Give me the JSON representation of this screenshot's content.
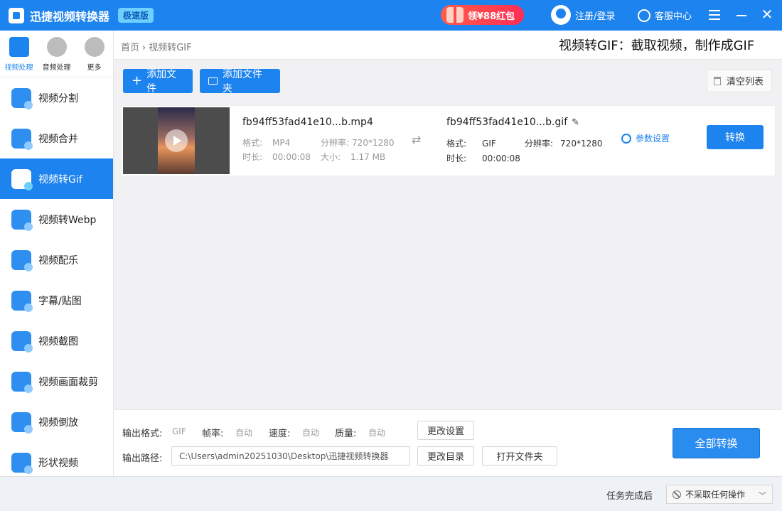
{
  "app": {
    "title": "迅捷视频转换器",
    "edition": "极速版",
    "promo": "领¥88红包",
    "login": "注册/登录",
    "service": "客服中心"
  },
  "sidebar": {
    "top_tabs": [
      {
        "label": "视频处理"
      },
      {
        "label": "音频处理"
      },
      {
        "label": "更多"
      }
    ],
    "items": [
      {
        "label": "视频分割"
      },
      {
        "label": "视频合并"
      },
      {
        "label": "视频转Gif"
      },
      {
        "label": "视频转Webp"
      },
      {
        "label": "视频配乐"
      },
      {
        "label": "字幕/贴图"
      },
      {
        "label": "视频截图"
      },
      {
        "label": "视频画面裁剪"
      },
      {
        "label": "视频倒放"
      },
      {
        "label": "形状视频"
      }
    ]
  },
  "header": {
    "breadcrumb_home": "首页",
    "breadcrumb_current": "视频转GIF",
    "headline": "视频转GIF：截取视频，制作成GIF"
  },
  "toolbar": {
    "add_file": "添加文件",
    "add_folder": "添加文件夹",
    "clear_list": "清空列表"
  },
  "file": {
    "source": {
      "name": "fb94ff53fad41e10...b.mp4",
      "format_label": "格式:",
      "format": "MP4",
      "resolution_label": "分辨率:",
      "resolution": "720*1280",
      "duration_label": "时长:",
      "duration": "00:00:08",
      "size_label": "大小:",
      "size": "1.17 MB"
    },
    "output": {
      "name": "fb94ff53fad41e10...b.gif",
      "format_label": "格式:",
      "format": "GIF",
      "resolution_label": "分辨率:",
      "resolution": "720*1280",
      "duration_label": "时长:",
      "duration": "00:00:08"
    },
    "settings_label": "参数设置",
    "convert_label": "转换"
  },
  "bottom": {
    "format_label": "输出格式:",
    "format_value": "GIF",
    "fps_label": "帧率:",
    "fps_value": "自动",
    "speed_label": "速度:",
    "speed_value": "自动",
    "quality_label": "质量:",
    "quality_value": "自动",
    "change_settings": "更改设置",
    "path_label": "输出路径:",
    "path_value": "C:\\Users\\admin20251030\\Desktop\\迅捷视频转换器",
    "change_dir": "更改目录",
    "open_folder": "打开文件夹",
    "convert_all": "全部转换"
  },
  "status": {
    "after_label": "任务完成后",
    "after_value": "不采取任何操作"
  }
}
